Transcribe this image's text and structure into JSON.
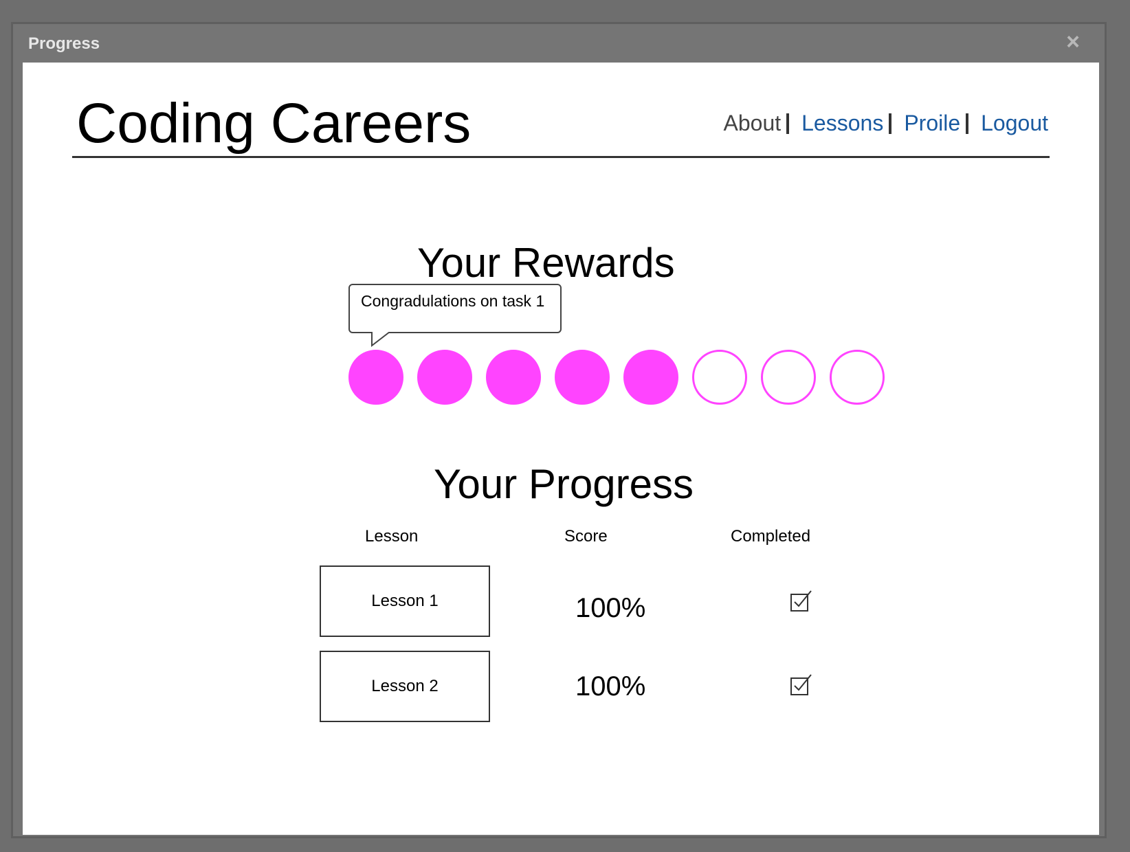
{
  "dialog": {
    "title": "Progress",
    "close_label": "×"
  },
  "header": {
    "brand": "Coding Careers",
    "nav": [
      {
        "label": "About"
      },
      {
        "label": "Lessons"
      },
      {
        "label": "Proile"
      },
      {
        "label": "Logout"
      }
    ]
  },
  "rewards": {
    "title": "Your Rewards",
    "tooltip": "Congradulations on task 1",
    "earned": 5,
    "total": 8,
    "color": "#ff44ff"
  },
  "progress": {
    "title": "Your Progress",
    "columns": [
      "Lesson",
      "Score",
      "Completed"
    ],
    "rows": [
      {
        "lesson": "Lesson 1",
        "score": "100%",
        "completed": true
      },
      {
        "lesson": "Lesson 2",
        "score": "100%",
        "completed": true
      }
    ]
  },
  "colors": {
    "link": "#1a5aa0",
    "reward": "#ff44ff",
    "chrome": "#6e6e6e"
  }
}
